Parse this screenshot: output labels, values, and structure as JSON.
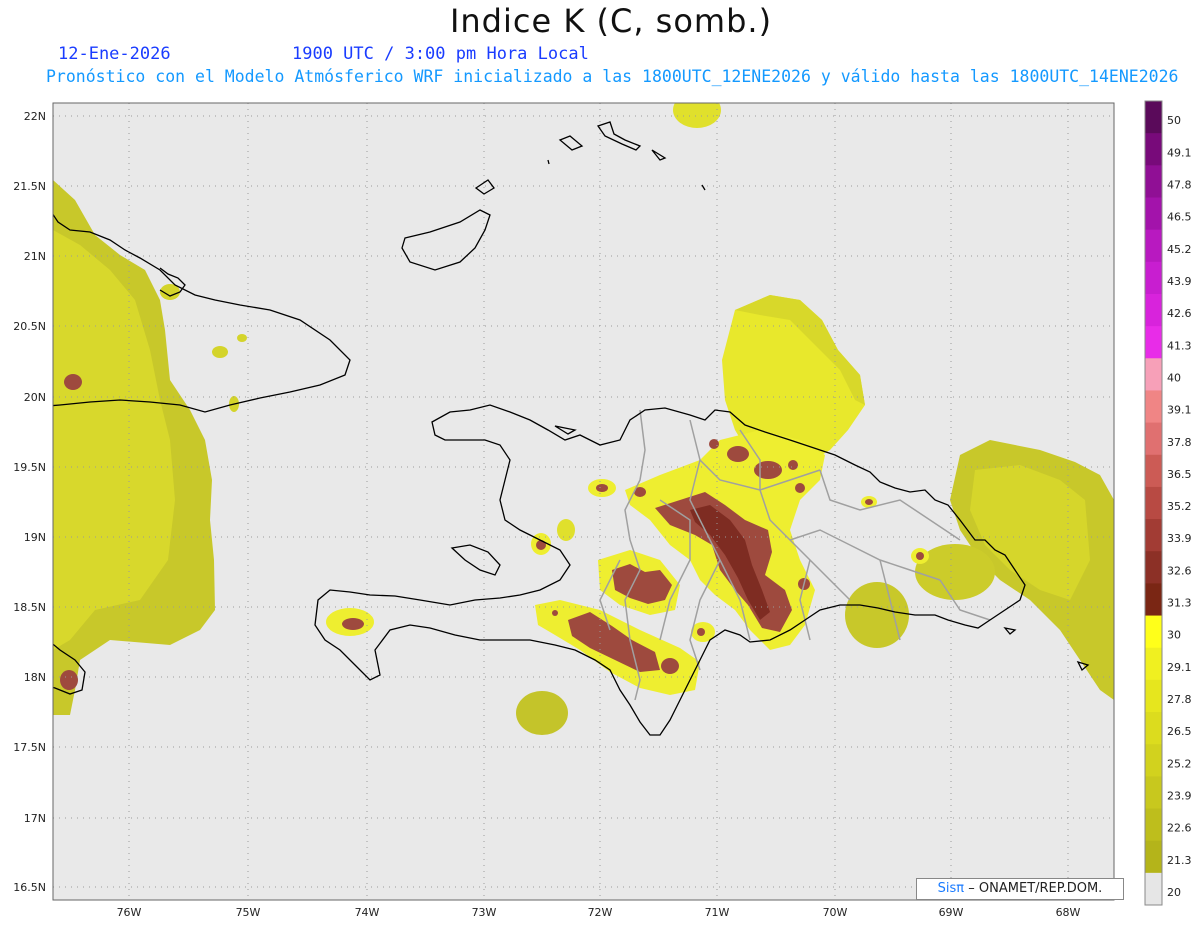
{
  "header": {
    "title": "Indice K (C, somb.)",
    "date": "12-Ene-2026",
    "time": "1900 UTC / 3:00 pm Hora Local",
    "forecast_note": "Pronóstico con el Modelo Atmósferico WRF inicializado a las 1800UTC_12ENE2026 y válido hasta las  1800UTC_14ENE2026"
  },
  "axes": {
    "lat_labels": [
      "22N",
      "21.5N",
      "21N",
      "20.5N",
      "20N",
      "19.5N",
      "19N",
      "18.5N",
      "18N",
      "17.5N",
      "17N",
      "16.5N"
    ],
    "lon_labels": [
      "76W",
      "75W",
      "74W",
      "73W",
      "72W",
      "71W",
      "70W",
      "69W",
      "68W"
    ]
  },
  "colorbar": {
    "labels": [
      "50",
      "49.1",
      "47.8",
      "46.5",
      "45.2",
      "43.9",
      "42.6",
      "41.3",
      "40",
      "39.1",
      "37.8",
      "36.5",
      "35.2",
      "33.9",
      "32.6",
      "31.3",
      "30",
      "29.1",
      "27.8",
      "26.5",
      "25.2",
      "23.9",
      "22.6",
      "21.3",
      "20"
    ],
    "colors": [
      "#5a0a5a",
      "#780a7a",
      "#900f95",
      "#a313ab",
      "#b819c0",
      "#c81ed0",
      "#d823dc",
      "#e82ce8",
      "#f7a0b8",
      "#f08585",
      "#e07070",
      "#cc5b55",
      "#b84a43",
      "#a23c34",
      "#8c3026",
      "#7a2614",
      "#ffff1a",
      "#f0f020",
      "#e6e61e",
      "#dcdc1e",
      "#d2d21e",
      "#c8c81e",
      "#bebe1c",
      "#b4b41a",
      "#e6e6e6"
    ]
  },
  "credit": {
    "brand": "Sisπ",
    "org": "– ONAMET/REP.DOM."
  },
  "field_colors": {
    "background": "#e9e9e9",
    "low": "#c6c62a",
    "mid": "#e4e42c",
    "high": "#f4f430",
    "storm": "#9e4a3e",
    "storm_core": "#7e2c22",
    "coast": "#000000",
    "province": "#9c9c9c"
  }
}
